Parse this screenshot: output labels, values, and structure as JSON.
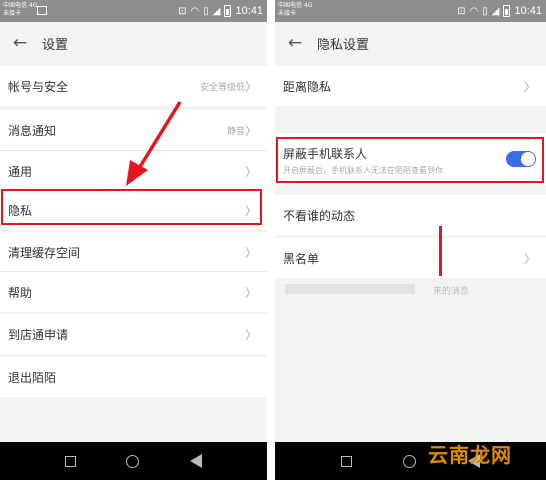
{
  "status": {
    "carrier_line1": "中国电信 4G",
    "carrier_line2": "未接卡",
    "time": "10:41"
  },
  "left": {
    "back_icon": "arrow-left-icon",
    "title": "设置",
    "rows": [
      {
        "label": "帐号与安全",
        "value": "安全等级低"
      },
      {
        "label": "消息通知",
        "value": "静音"
      },
      {
        "label": "通用",
        "value": ""
      },
      {
        "label": "隐私",
        "value": ""
      },
      {
        "label": "清理缓存空间",
        "value": ""
      },
      {
        "label": "帮助",
        "value": ""
      },
      {
        "label": "到店通申请",
        "value": ""
      },
      {
        "label": "退出陌陌",
        "value": ""
      }
    ]
  },
  "right": {
    "back_icon": "arrow-left-icon",
    "title": "隐私设置",
    "rows": [
      {
        "label": "距离隐私",
        "desc": ""
      },
      {
        "label": "屏蔽手机联系人",
        "desc": "开启屏蔽后，手机联系人无法在陌陌查看到你",
        "toggle_on": true
      },
      {
        "label": "不看谁的动态",
        "desc": ""
      },
      {
        "label": "黑名单",
        "desc": ""
      }
    ],
    "footer_text": "来的消息"
  },
  "watermark": "云南龙网",
  "colors": {
    "highlight": "#e1161e",
    "toggle": "#3d6de4",
    "watermark": "#e08a00"
  }
}
